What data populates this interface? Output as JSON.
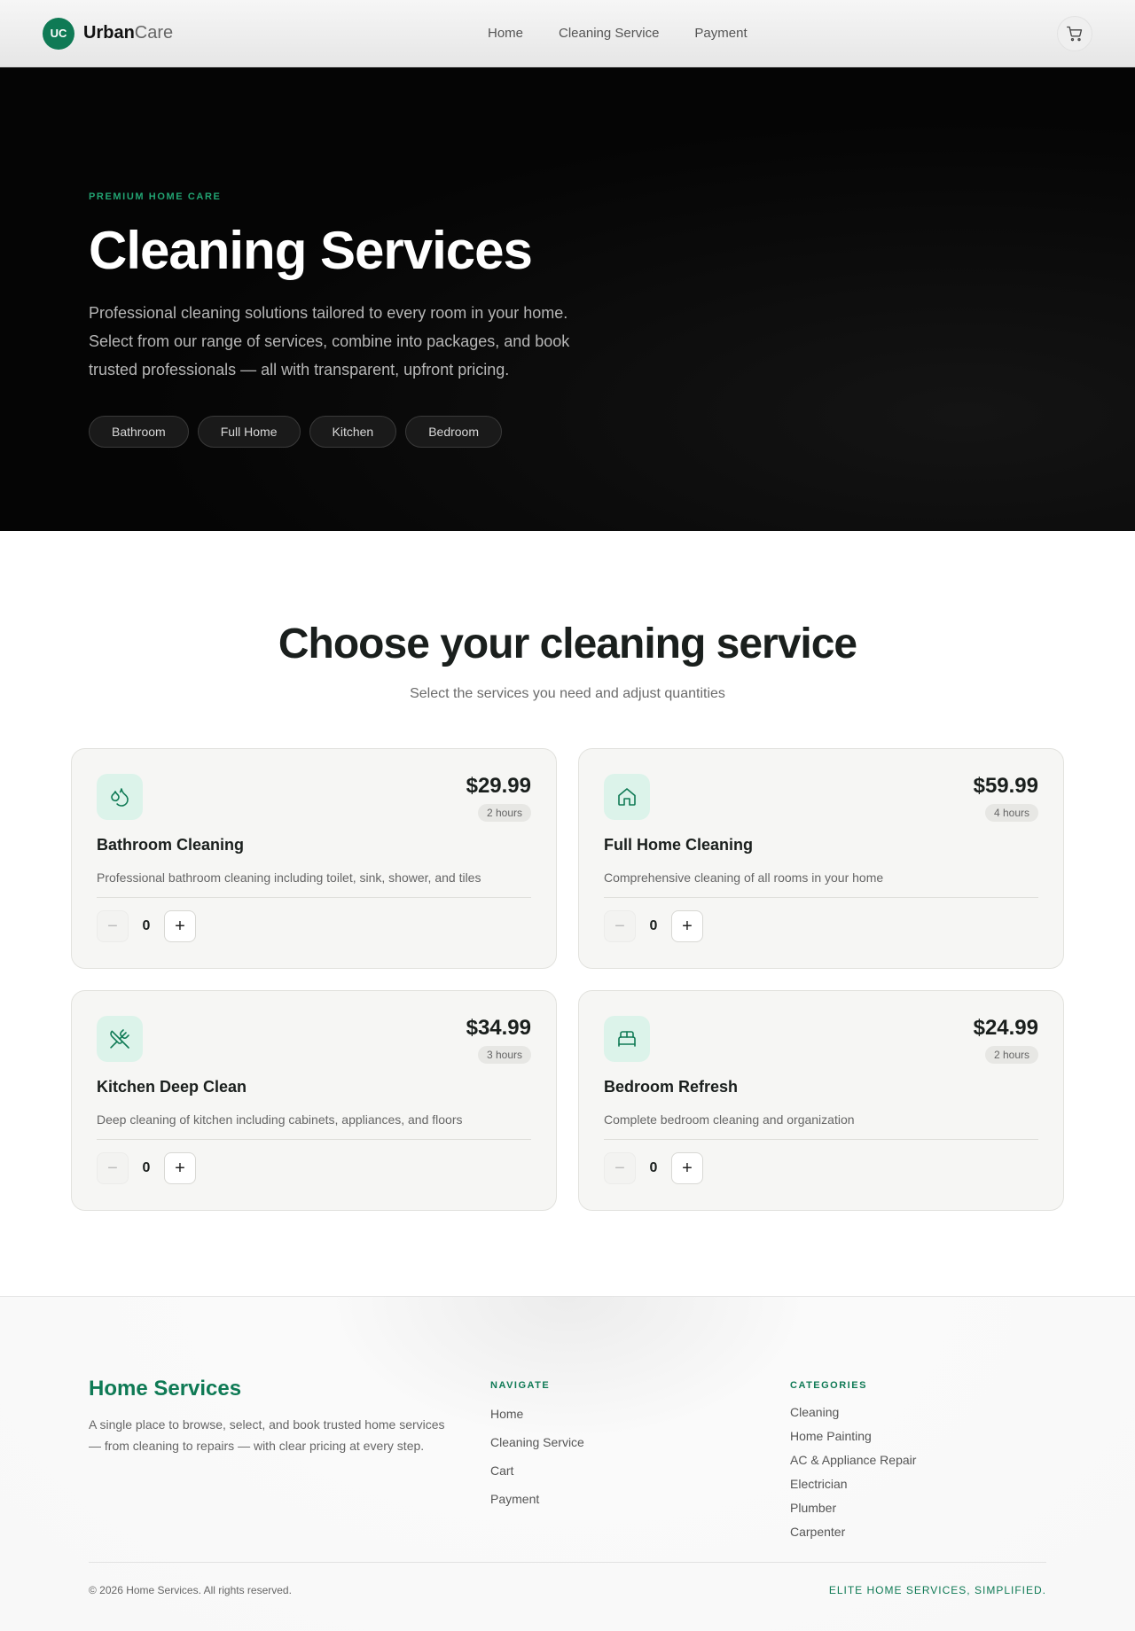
{
  "nav": {
    "logo_initials": "UC",
    "brand_bold": "Urban",
    "brand_light": "Care",
    "links": [
      {
        "label": "Home"
      },
      {
        "label": "Cleaning Service"
      },
      {
        "label": "Payment"
      }
    ],
    "cart_icon": "cart-icon"
  },
  "hero": {
    "kicker": "PREMIUM HOME CARE",
    "title": "Cleaning Services",
    "description": "Professional cleaning solutions tailored to every room in your home. Select from our range of services, combine into packages, and book trusted professionals — all with transparent, upfront pricing.",
    "chips": [
      "Bathroom",
      "Full Home",
      "Kitchen",
      "Bedroom"
    ]
  },
  "services": {
    "title": "Choose your cleaning service",
    "subtitle": "Select the services you need and adjust quantities",
    "items": [
      {
        "icon": "droplets-icon",
        "price": "$29.99",
        "duration": "2 hours",
        "title": "Bathroom Cleaning",
        "description": "Professional bathroom cleaning including toilet, sink, shower, and tiles",
        "quantity": "0"
      },
      {
        "icon": "home-icon",
        "price": "$59.99",
        "duration": "4 hours",
        "title": "Full Home Cleaning",
        "description": "Comprehensive cleaning of all rooms in your home",
        "quantity": "0"
      },
      {
        "icon": "utensils-icon",
        "price": "$34.99",
        "duration": "3 hours",
        "title": "Kitchen Deep Clean",
        "description": "Deep cleaning of kitchen including cabinets, appliances, and floors",
        "quantity": "0"
      },
      {
        "icon": "bed-icon",
        "price": "$24.99",
        "duration": "2 hours",
        "title": "Bedroom Refresh",
        "description": "Complete bedroom cleaning and organization",
        "quantity": "0"
      }
    ]
  },
  "footer": {
    "title": "Home Services",
    "description": "A single place to browse, select, and book trusted home services — from cleaning to repairs — with clear pricing at every step.",
    "navigate_heading": "NAVIGATE",
    "navigate_links": [
      "Home",
      "Cleaning Service",
      "Cart",
      "Payment"
    ],
    "categories_heading": "CATEGORIES",
    "categories_links": [
      "Cleaning",
      "Home Painting",
      "AC & Appliance Repair",
      "Electrician",
      "Plumber",
      "Carpenter"
    ],
    "copyright": "© 2026 Home Services. All rights reserved.",
    "tagline": "ELITE HOME SERVICES, SIMPLIFIED."
  },
  "colors": {
    "accent": "#0f7a55",
    "hero_bg": "#060606",
    "icon_bg": "#dcf3ea"
  }
}
